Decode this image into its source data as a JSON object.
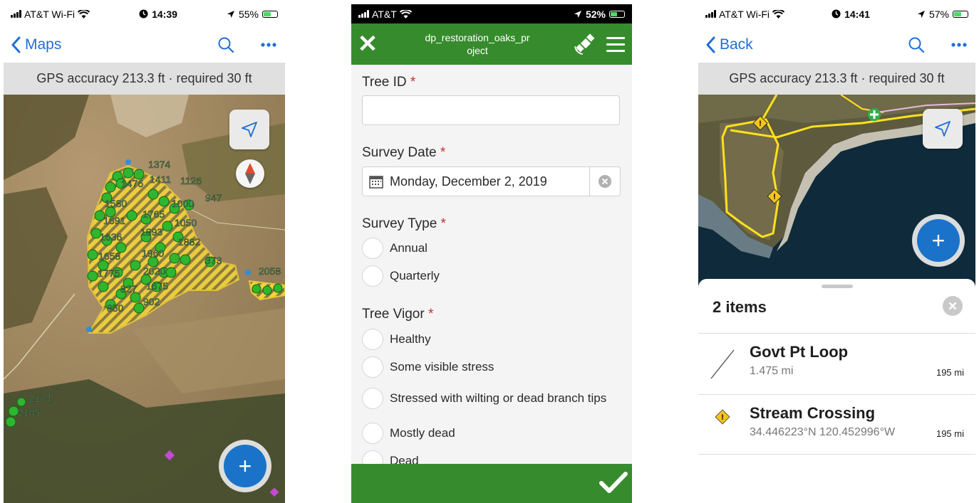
{
  "phone1": {
    "status": {
      "carrier": "AT&T Wi-Fi",
      "time": "14:39",
      "battery": "55%",
      "battery_level": 0.55
    },
    "nav": {
      "back_label": "Maps",
      "back_icon": "chevron-left-icon",
      "search_icon": "search-icon",
      "more_icon": "more-icon"
    },
    "gps_banner": "GPS accuracy 213.3 ft · required 30 ft",
    "map": {
      "feature_labels": [
        "1374",
        "1411",
        "1126",
        "1476",
        "947",
        "1580",
        "1765",
        "1000",
        "1691",
        "1050",
        "1636",
        "1893",
        "1882",
        "1658",
        "1960",
        "373",
        "1775",
        "2020",
        "2058",
        "827",
        "1675",
        "902",
        "850",
        "2174",
        "2185"
      ],
      "locate_icon": "navigation-arrow-icon",
      "compass_icon": "compass-icon",
      "add_icon": "plus-icon",
      "add_label": "+",
      "polygon_fill": "#f2d33c",
      "point_color": "#2fb52f",
      "accent": "#1a73c8"
    }
  },
  "phone2": {
    "status": {
      "carrier": "AT&T",
      "battery": "52%",
      "battery_level": 0.52
    },
    "header": {
      "title": "dp_restoration_oaks_project",
      "title_line1": "dp_restoration_oaks_pr",
      "title_line2": "oject",
      "close_icon": "close-icon",
      "close_glyph": "✕",
      "gps_icon": "satellite-icon",
      "menu_icon": "menu-icon",
      "bg": "#368c2c"
    },
    "form": {
      "tree_id": {
        "label": "Tree ID",
        "required": "*",
        "value": ""
      },
      "survey_date": {
        "label": "Survey Date",
        "required": "*",
        "value": "Monday, December 2, 2019",
        "calendar_icon": "calendar-icon",
        "clear_icon": "clear-icon"
      },
      "survey_type": {
        "label": "Survey Type",
        "required": "*",
        "options": [
          "Annual",
          "Quarterly"
        ]
      },
      "tree_vigor": {
        "label": "Tree Vigor",
        "required": "*",
        "options": [
          "Healthy",
          "Some visible stress",
          "Stressed with wilting or dead branch tips",
          "Mostly dead",
          "Dead"
        ]
      }
    },
    "footer": {
      "submit_icon": "checkmark-icon"
    }
  },
  "phone3": {
    "status": {
      "carrier": "AT&T Wi-Fi",
      "time": "14:41",
      "battery": "57%",
      "battery_level": 0.57
    },
    "nav": {
      "back_label": "Back",
      "back_icon": "chevron-left-icon",
      "search_icon": "search-icon",
      "more_icon": "more-icon"
    },
    "gps_banner": "GPS accuracy 213.3 ft · required 30 ft",
    "map": {
      "locate_icon": "navigation-arrow-icon",
      "add_icon": "plus-icon",
      "add_label": "+"
    },
    "results": {
      "title": "2 items",
      "close_icon": "close-circle-icon",
      "items": [
        {
          "name": "Govt Pt Loop",
          "subtitle": "1.475 mi",
          "distance": "195 mi",
          "icon": "line-feature-icon"
        },
        {
          "name": "Stream Crossing",
          "subtitle": "34.446223°N 120.452996°W",
          "distance": "195 mi",
          "icon": "warning-diamond-icon"
        }
      ]
    }
  }
}
